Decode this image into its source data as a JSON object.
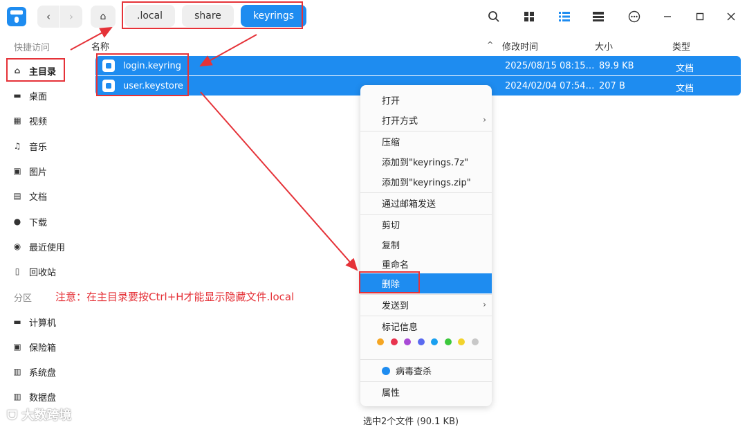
{
  "breadcrumbs": [
    ".local",
    "share",
    "keyrings"
  ],
  "sidebar": {
    "group_quick": "快捷访问",
    "items": [
      {
        "label": "主目录",
        "icon": "home-icon"
      },
      {
        "label": "桌面",
        "icon": "desktop-icon"
      },
      {
        "label": "视频",
        "icon": "video-icon"
      },
      {
        "label": "音乐",
        "icon": "music-icon"
      },
      {
        "label": "图片",
        "icon": "picture-icon"
      },
      {
        "label": "文档",
        "icon": "document-icon"
      },
      {
        "label": "下载",
        "icon": "download-icon"
      },
      {
        "label": "最近使用",
        "icon": "clock-icon"
      },
      {
        "label": "回收站",
        "icon": "trash-icon"
      }
    ],
    "group_partition": "分区",
    "partitions": [
      {
        "label": "计算机",
        "icon": "computer-icon"
      },
      {
        "label": "保险箱",
        "icon": "vault-icon"
      },
      {
        "label": "系统盘",
        "icon": "disk-icon"
      },
      {
        "label": "数据盘",
        "icon": "disk-icon"
      }
    ]
  },
  "columns": {
    "name": "名称",
    "modified": "修改时间",
    "size": "大小",
    "type": "类型"
  },
  "files": [
    {
      "name": "login.keyring",
      "modified": "2025/08/15 08:15…",
      "size": "89.9 KB",
      "type": "文档"
    },
    {
      "name": "user.keystore",
      "modified": "2024/02/04 07:54…",
      "size": "207 B",
      "type": "文档"
    }
  ],
  "context_menu": {
    "open": "打开",
    "open_with": "打开方式",
    "compress": "压缩",
    "add_7z": "添加到\"keyrings.7z\"",
    "add_zip": "添加到\"keyrings.zip\"",
    "send_mail": "通过邮箱发送",
    "cut": "剪切",
    "copy": "复制",
    "rename": "重命名",
    "delete": "删除",
    "send_to": "发送到",
    "tag_info": "标记信息",
    "tag_colors": [
      "#f5a623",
      "#e8344e",
      "#a84ad6",
      "#5a6af0",
      "#1aa0f0",
      "#3cc83c",
      "#f2d32c",
      "#c8c8c8"
    ],
    "virus_scan": "病毒查杀",
    "properties": "属性"
  },
  "status": "选中2个文件 (90.1 KB)",
  "annotation_note": "注意：在主目录要按Ctrl+H才能显示隐藏文件.local",
  "watermark": "大数跨境",
  "colors": {
    "accent": "#1e8cf0",
    "annotation": "#e53238"
  }
}
